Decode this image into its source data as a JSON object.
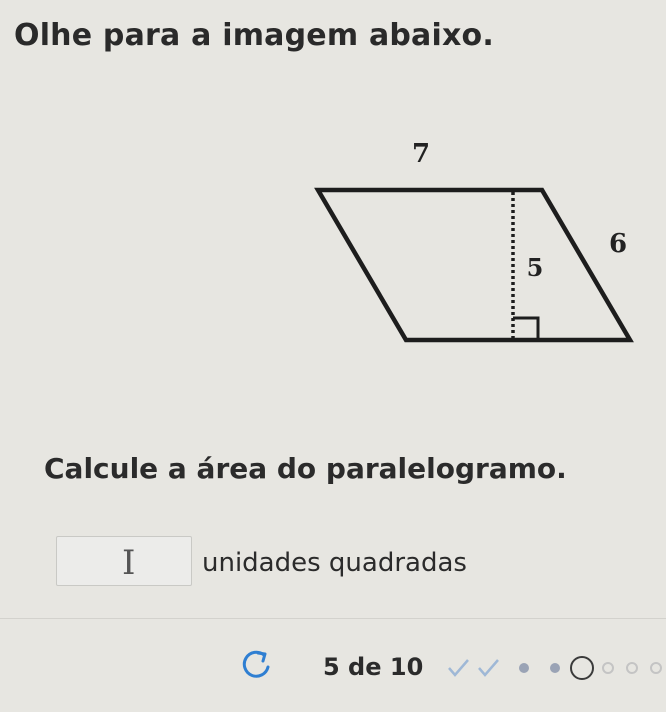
{
  "instruction": "Olhe para a imagem abaixo.",
  "figure": {
    "labels": {
      "top": "7",
      "height": "5",
      "side": "6"
    }
  },
  "question": "Calcule a área do paralelogramo.",
  "answer": {
    "value": "",
    "unit": "unidades quadradas"
  },
  "footer": {
    "progress_text": "5 de 10",
    "current": 5,
    "total": 10,
    "marks": [
      "check",
      "check",
      "dot",
      "dot",
      "current",
      "empty",
      "empty",
      "empty"
    ]
  },
  "colors": {
    "background": "#e7e6e1",
    "text": "#2b2b2b",
    "check": "#9fb8d6",
    "dot": "#9aa3b5",
    "empty_ring": "#c4c4c4"
  }
}
